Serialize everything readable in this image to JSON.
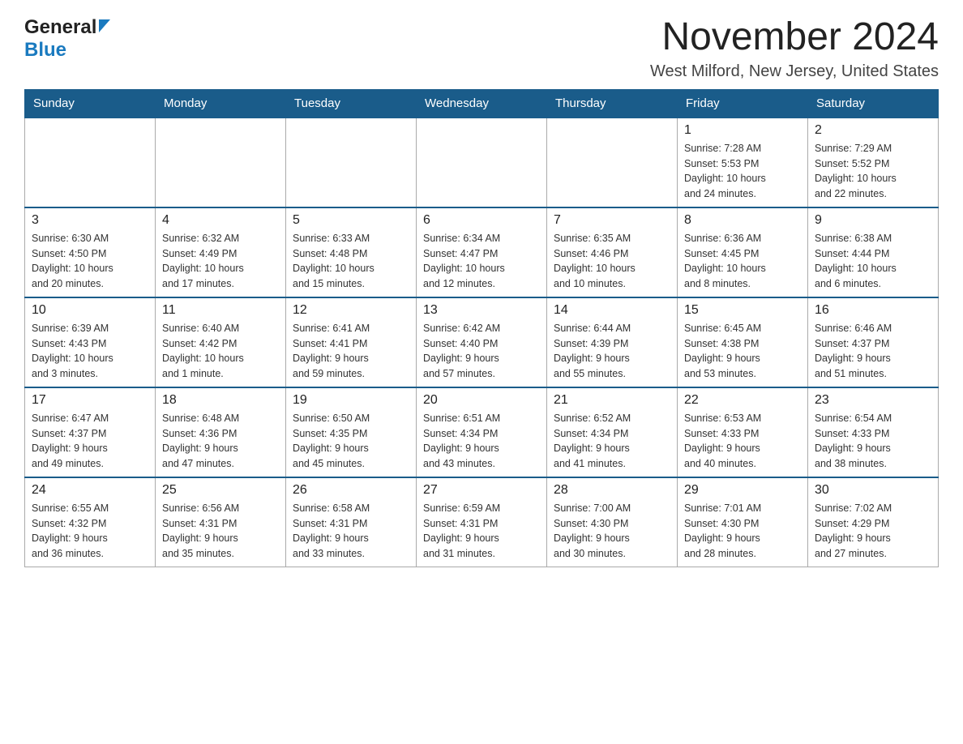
{
  "logo": {
    "general": "General",
    "blue": "Blue"
  },
  "header": {
    "month_year": "November 2024",
    "location": "West Milford, New Jersey, United States"
  },
  "weekdays": [
    "Sunday",
    "Monday",
    "Tuesday",
    "Wednesday",
    "Thursday",
    "Friday",
    "Saturday"
  ],
  "weeks": [
    {
      "days": [
        {
          "number": "",
          "info": ""
        },
        {
          "number": "",
          "info": ""
        },
        {
          "number": "",
          "info": ""
        },
        {
          "number": "",
          "info": ""
        },
        {
          "number": "",
          "info": ""
        },
        {
          "number": "1",
          "info": "Sunrise: 7:28 AM\nSunset: 5:53 PM\nDaylight: 10 hours\nand 24 minutes."
        },
        {
          "number": "2",
          "info": "Sunrise: 7:29 AM\nSunset: 5:52 PM\nDaylight: 10 hours\nand 22 minutes."
        }
      ]
    },
    {
      "days": [
        {
          "number": "3",
          "info": "Sunrise: 6:30 AM\nSunset: 4:50 PM\nDaylight: 10 hours\nand 20 minutes."
        },
        {
          "number": "4",
          "info": "Sunrise: 6:32 AM\nSunset: 4:49 PM\nDaylight: 10 hours\nand 17 minutes."
        },
        {
          "number": "5",
          "info": "Sunrise: 6:33 AM\nSunset: 4:48 PM\nDaylight: 10 hours\nand 15 minutes."
        },
        {
          "number": "6",
          "info": "Sunrise: 6:34 AM\nSunset: 4:47 PM\nDaylight: 10 hours\nand 12 minutes."
        },
        {
          "number": "7",
          "info": "Sunrise: 6:35 AM\nSunset: 4:46 PM\nDaylight: 10 hours\nand 10 minutes."
        },
        {
          "number": "8",
          "info": "Sunrise: 6:36 AM\nSunset: 4:45 PM\nDaylight: 10 hours\nand 8 minutes."
        },
        {
          "number": "9",
          "info": "Sunrise: 6:38 AM\nSunset: 4:44 PM\nDaylight: 10 hours\nand 6 minutes."
        }
      ]
    },
    {
      "days": [
        {
          "number": "10",
          "info": "Sunrise: 6:39 AM\nSunset: 4:43 PM\nDaylight: 10 hours\nand 3 minutes."
        },
        {
          "number": "11",
          "info": "Sunrise: 6:40 AM\nSunset: 4:42 PM\nDaylight: 10 hours\nand 1 minute."
        },
        {
          "number": "12",
          "info": "Sunrise: 6:41 AM\nSunset: 4:41 PM\nDaylight: 9 hours\nand 59 minutes."
        },
        {
          "number": "13",
          "info": "Sunrise: 6:42 AM\nSunset: 4:40 PM\nDaylight: 9 hours\nand 57 minutes."
        },
        {
          "number": "14",
          "info": "Sunrise: 6:44 AM\nSunset: 4:39 PM\nDaylight: 9 hours\nand 55 minutes."
        },
        {
          "number": "15",
          "info": "Sunrise: 6:45 AM\nSunset: 4:38 PM\nDaylight: 9 hours\nand 53 minutes."
        },
        {
          "number": "16",
          "info": "Sunrise: 6:46 AM\nSunset: 4:37 PM\nDaylight: 9 hours\nand 51 minutes."
        }
      ]
    },
    {
      "days": [
        {
          "number": "17",
          "info": "Sunrise: 6:47 AM\nSunset: 4:37 PM\nDaylight: 9 hours\nand 49 minutes."
        },
        {
          "number": "18",
          "info": "Sunrise: 6:48 AM\nSunset: 4:36 PM\nDaylight: 9 hours\nand 47 minutes."
        },
        {
          "number": "19",
          "info": "Sunrise: 6:50 AM\nSunset: 4:35 PM\nDaylight: 9 hours\nand 45 minutes."
        },
        {
          "number": "20",
          "info": "Sunrise: 6:51 AM\nSunset: 4:34 PM\nDaylight: 9 hours\nand 43 minutes."
        },
        {
          "number": "21",
          "info": "Sunrise: 6:52 AM\nSunset: 4:34 PM\nDaylight: 9 hours\nand 41 minutes."
        },
        {
          "number": "22",
          "info": "Sunrise: 6:53 AM\nSunset: 4:33 PM\nDaylight: 9 hours\nand 40 minutes."
        },
        {
          "number": "23",
          "info": "Sunrise: 6:54 AM\nSunset: 4:33 PM\nDaylight: 9 hours\nand 38 minutes."
        }
      ]
    },
    {
      "days": [
        {
          "number": "24",
          "info": "Sunrise: 6:55 AM\nSunset: 4:32 PM\nDaylight: 9 hours\nand 36 minutes."
        },
        {
          "number": "25",
          "info": "Sunrise: 6:56 AM\nSunset: 4:31 PM\nDaylight: 9 hours\nand 35 minutes."
        },
        {
          "number": "26",
          "info": "Sunrise: 6:58 AM\nSunset: 4:31 PM\nDaylight: 9 hours\nand 33 minutes."
        },
        {
          "number": "27",
          "info": "Sunrise: 6:59 AM\nSunset: 4:31 PM\nDaylight: 9 hours\nand 31 minutes."
        },
        {
          "number": "28",
          "info": "Sunrise: 7:00 AM\nSunset: 4:30 PM\nDaylight: 9 hours\nand 30 minutes."
        },
        {
          "number": "29",
          "info": "Sunrise: 7:01 AM\nSunset: 4:30 PM\nDaylight: 9 hours\nand 28 minutes."
        },
        {
          "number": "30",
          "info": "Sunrise: 7:02 AM\nSunset: 4:29 PM\nDaylight: 9 hours\nand 27 minutes."
        }
      ]
    }
  ]
}
